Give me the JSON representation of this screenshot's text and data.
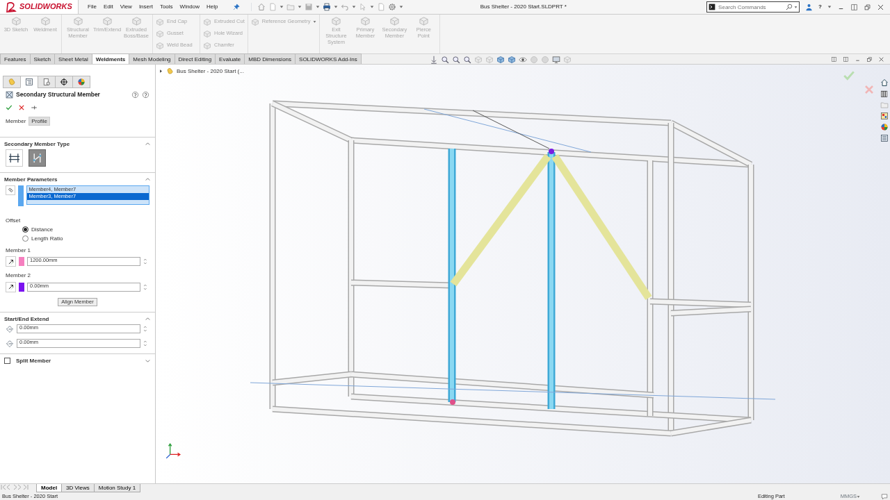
{
  "app": {
    "logo": "SOLIDWORKS",
    "menu": [
      "File",
      "Edit",
      "View",
      "Insert",
      "Tools",
      "Window",
      "Help"
    ],
    "title": "Bus Shelter - 2020 Start.SLDPRT *",
    "search": {
      "placeholder": "Search Commands"
    },
    "help": "?"
  },
  "commands": [
    {
      "kind": "large",
      "items": [
        {
          "label": "3D Sketch",
          "disabled": true
        },
        {
          "label": "Weldment",
          "disabled": true
        }
      ]
    },
    {
      "kind": "large",
      "items": [
        {
          "label": "Structural Member",
          "disabled": true
        },
        {
          "label": "Trim/Extend",
          "disabled": true
        },
        {
          "label": "Extruded Boss/Base",
          "disabled": true
        }
      ]
    },
    {
      "kind": "small",
      "items": [
        {
          "label": "End Cap",
          "disabled": true
        },
        {
          "label": "Gusset",
          "disabled": true
        },
        {
          "label": "Weld Bead",
          "disabled": true
        }
      ]
    },
    {
      "kind": "small",
      "items": [
        {
          "label": "Extruded Cut",
          "disabled": true
        },
        {
          "label": "Hole Wizard",
          "disabled": true
        },
        {
          "label": "Chamfer",
          "disabled": true
        }
      ]
    },
    {
      "kind": "small",
      "items": [
        {
          "label": "Reference Geometry",
          "disabled": true
        }
      ]
    },
    {
      "kind": "large",
      "items": [
        {
          "label": "Exit Structure System",
          "disabled": true
        },
        {
          "label": "Primary Member",
          "disabled": true
        },
        {
          "label": "Secondary Member",
          "disabled": true
        },
        {
          "label": "Pierce Point",
          "disabled": true
        }
      ]
    }
  ],
  "tabs": [
    {
      "label": "Features",
      "selected": false
    },
    {
      "label": "Sketch",
      "selected": false
    },
    {
      "label": "Sheet Metal",
      "selected": false
    },
    {
      "label": "Weldments",
      "selected": true
    },
    {
      "label": "Mesh Modeling",
      "selected": false
    },
    {
      "label": "Direct Editing",
      "selected": false
    },
    {
      "label": "Evaluate",
      "selected": false
    },
    {
      "label": "MBD Dimensions",
      "selected": false
    },
    {
      "label": "SOLIDWORKS Add-Ins",
      "selected": false
    }
  ],
  "panel": {
    "tabs": [
      {
        "selected": false
      },
      {
        "selected": true
      },
      {
        "selected": false
      },
      {
        "selected": false
      },
      {
        "selected": false
      }
    ],
    "title": "Secondary Structural Member",
    "subtabs": [
      {
        "label": "Member",
        "selected": true
      },
      {
        "label": "Profile",
        "selected": false
      }
    ],
    "member_type": {
      "heading": "Secondary Member Type",
      "expanded": true,
      "options": [
        {
          "selected": false
        },
        {
          "selected": true
        }
      ]
    },
    "member_parameters": {
      "heading": "Member Parameters",
      "expanded": true,
      "items": [
        {
          "label": "Member4, Member7",
          "selected": false
        },
        {
          "label": "Member3, Member7",
          "selected": true
        }
      ],
      "offset_label": "Offset",
      "offset_options": [
        {
          "label": "Distance",
          "selected": true
        },
        {
          "label": "Length Ratio",
          "selected": false
        }
      ],
      "members": [
        {
          "label": "Member 1",
          "color": "#f57fbf",
          "value": "1200.00mm"
        },
        {
          "label": "Member 2",
          "color": "#7b12f0",
          "value": "0.00mm"
        }
      ],
      "align_button": "Align Member"
    },
    "extend": {
      "heading": "Start/End Extend",
      "expanded": true,
      "values": [
        "0.00mm",
        "0.00mm"
      ]
    },
    "split": {
      "label": "Split Member",
      "checked": false,
      "expanded": false
    }
  },
  "viewport": {
    "tree_label": "Bus Shelter - 2020 Start  (..."
  },
  "bottom_tabs": [
    {
      "label": "Model",
      "selected": true
    },
    {
      "label": "3D Views",
      "selected": false
    },
    {
      "label": "Motion Study 1",
      "selected": false
    }
  ],
  "status": {
    "document": "Bus Shelter - 2020 Start",
    "mode": "Editing Part",
    "units": "MMGS"
  }
}
